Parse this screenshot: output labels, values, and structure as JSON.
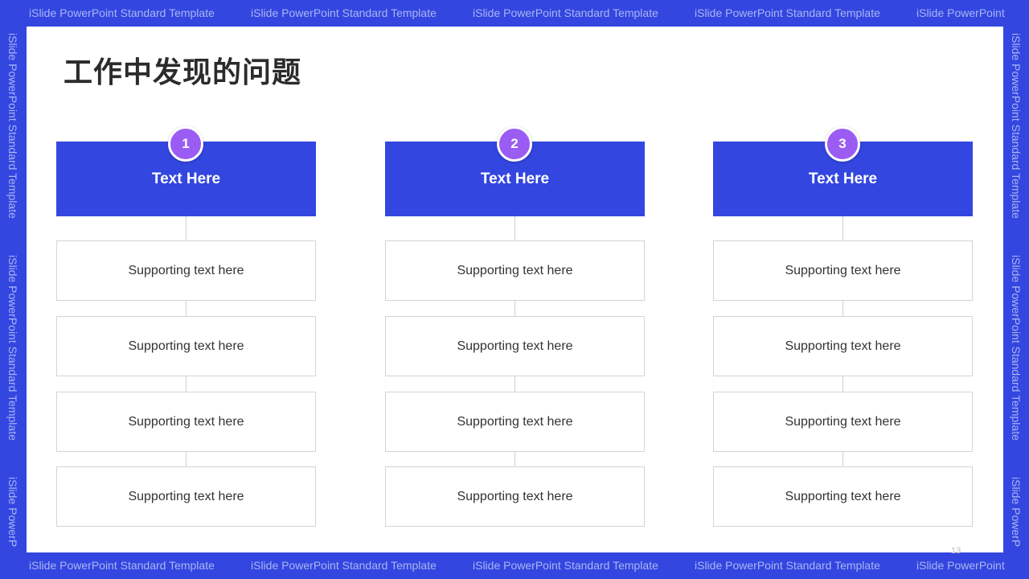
{
  "watermark": "iSlide PowerPoint Standard Template",
  "watermark_partial": "iSlide PowerPoint",
  "watermark_side_partial": "iSlide PowerP",
  "title": "工作中发现的问题",
  "columns": [
    {
      "number": "1",
      "heading": "Text Here",
      "items": [
        "Supporting text here",
        "Supporting text here",
        "Supporting text here",
        "Supporting text here"
      ]
    },
    {
      "number": "2",
      "heading": "Text Here",
      "items": [
        "Supporting text here",
        "Supporting text here",
        "Supporting text here",
        "Supporting text here"
      ]
    },
    {
      "number": "3",
      "heading": "Text Here",
      "items": [
        "Supporting text here",
        "Supporting text here",
        "Supporting text here",
        "Supporting text here"
      ]
    }
  ],
  "page_number": "13",
  "colors": {
    "frame": "#3346e0",
    "header": "#3346e0",
    "badge": "#9b5cf3",
    "watermark_text": "#aab5f2"
  }
}
